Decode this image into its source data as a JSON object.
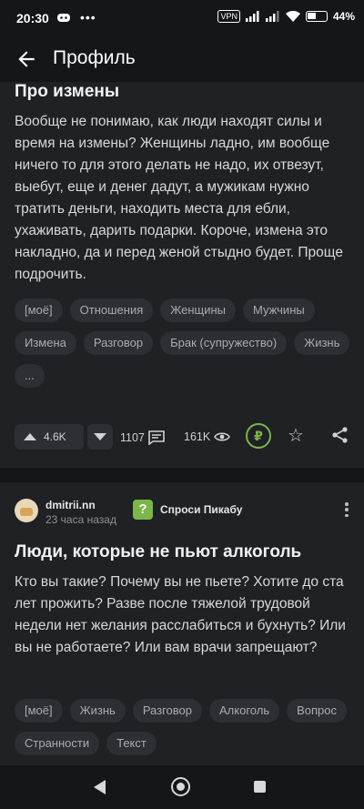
{
  "status_bar": {
    "time": "20:30",
    "battery": "44%",
    "vpn": "VPN"
  },
  "app_bar": {
    "title": "Профиль"
  },
  "post1": {
    "title": "Про измены",
    "text": "Вообще не понимаю, как люди находят силы и время на измены? Женщины ладно, им вообще ничего то для этого делать не надо, их отвезут, выебут, еще и денег дадут, а мужикам нужно тратить деньги, находить места для ебли, ухаживать, дарить подарки. Короче, измена это накладно, да и перед женой стыдно будет. Проще подрочить.",
    "tags": [
      "[моё]",
      "Отношения",
      "Женщины",
      "Мужчины",
      "Измена",
      "Разговор",
      "Брак (супружество)",
      "Жизнь",
      "..."
    ],
    "rating": "4.6K",
    "comments": "1107",
    "views": "161K"
  },
  "post2": {
    "author": "dmitrii.nn",
    "time_ago": "23 часа назад",
    "community": "Спроси Пикабу",
    "title": "Люди, которые не пьют алкоголь",
    "text": "Кто вы такие? Почему вы не пьете? Хотите до ста лет прожить? Разве после тяжелой трудовой недели нет желания расслабиться и бухнуть? Или вы не работаете? Или вам врачи запрещают?",
    "tags": [
      "[моё]",
      "Жизнь",
      "Разговор",
      "Алкоголь",
      "Вопрос",
      "Странности",
      "Текст"
    ]
  },
  "colors": {
    "background": "#1f2124",
    "bar": "#141618",
    "accent": "#7ab648",
    "chip": "#2c2f33"
  }
}
